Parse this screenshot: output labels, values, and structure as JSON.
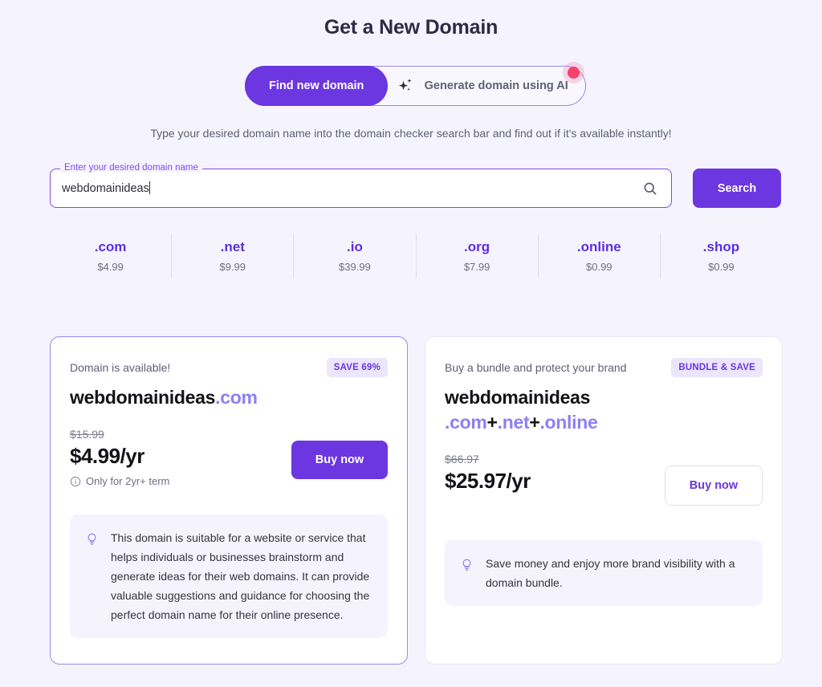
{
  "page": {
    "title": "Get a New Domain",
    "subtitle": "Type your desired domain name into the domain checker search bar and find out if it's available instantly!",
    "background_color": "#f5f4fe",
    "accent_color": "#6c36e0",
    "accent_light_color": "#8d80f4",
    "notification_dot_color": "#f5436f"
  },
  "mode_toggle": {
    "active_label": "Find new domain",
    "inactive_label": "Generate domain using AI",
    "inactive_icon": "ai-sparkle-icon",
    "notification_dot": "new-feature-dot"
  },
  "search": {
    "label": "Enter your desired domain name",
    "value": "webdomainideas",
    "placeholder": "Enter your desired domain name",
    "icon": "search-icon",
    "button_label": "Search"
  },
  "tlds": [
    {
      "name": ".com",
      "price": "$4.99"
    },
    {
      "name": ".net",
      "price": "$9.99"
    },
    {
      "name": ".io",
      "price": "$39.99"
    },
    {
      "name": ".org",
      "price": "$7.99"
    },
    {
      "name": ".online",
      "price": "$0.99"
    },
    {
      "name": ".shop",
      "price": "$0.99"
    }
  ],
  "result_card": {
    "eyebrow": "Domain is available!",
    "badge": "SAVE 69%",
    "domain_name": "webdomainideas",
    "domain_tld": ".com",
    "price_old": "$15.99",
    "price_now": "$4.99/yr",
    "price_note": "Only for 2yr+ term",
    "price_note_icon": "info-icon",
    "buy_label": "Buy now",
    "tip_icon": "lightbulb-icon",
    "tip_text": "This domain is suitable for a website or service that helps individuals or businesses brainstorm and generate ideas for their web domains. It can provide valuable suggestions and guidance for choosing the perfect domain name for their online presence."
  },
  "bundle_card": {
    "eyebrow": "Buy a bundle and protect your brand",
    "badge": "BUNDLE & SAVE",
    "domain_name": "webdomainideas",
    "tld_1": ".com",
    "plus_1": "+",
    "tld_2": ".net",
    "plus_2": "+",
    "tld_3": ".online",
    "price_old": "$66.97",
    "price_now": "$25.97/yr",
    "buy_label": "Buy now",
    "tip_icon": "lightbulb-icon",
    "tip_text": "Save money and enjoy more brand visibility with a domain bundle."
  }
}
